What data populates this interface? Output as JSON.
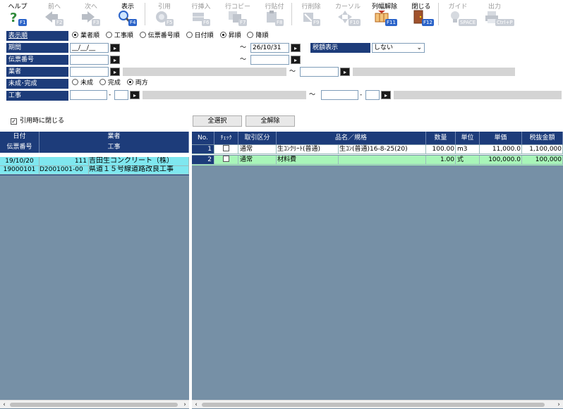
{
  "toolbar": {
    "help": {
      "label": "ヘルプ",
      "key": "F1",
      "icon": "help-question-icon"
    },
    "prev": {
      "label": "前へ",
      "key": "F2",
      "icon": "arrow-left-icon"
    },
    "next": {
      "label": "次へ",
      "key": "F3",
      "icon": "arrow-right-icon"
    },
    "show": {
      "label": "表示",
      "key": "F4",
      "icon": "magnifier-icon"
    },
    "cite": {
      "label": "引用",
      "key": "F5",
      "icon": "cite-icon"
    },
    "row_insert": {
      "label": "行挿入",
      "key": "F6",
      "icon": "row-insert-icon"
    },
    "row_copy": {
      "label": "行コピー",
      "key": "F7",
      "icon": "row-copy-icon"
    },
    "row_paste": {
      "label": "行貼付",
      "key": "F8",
      "icon": "row-paste-icon"
    },
    "row_delete": {
      "label": "行削除",
      "key": "F9",
      "icon": "row-delete-icon"
    },
    "cursor": {
      "label": "カーソル",
      "key": "F10",
      "icon": "cursor-icon"
    },
    "col_reset": {
      "label": "列幅解除",
      "key": "F11",
      "icon": "column-width-icon"
    },
    "close": {
      "label": "閉じる",
      "key": "F12",
      "icon": "door-close-icon"
    },
    "guide": {
      "label": "ガイド",
      "key": "SPACE",
      "icon": "lightbulb-icon"
    },
    "output": {
      "label": "出力",
      "key": "Ctrl+P",
      "icon": "printer-icon"
    }
  },
  "form": {
    "order_label": "表示順",
    "order_options": [
      "業者順",
      "工事順",
      "伝票番号順",
      "日付順"
    ],
    "order_selected": "業者順",
    "dir_options": [
      "昇順",
      "降順"
    ],
    "dir_selected": "昇順",
    "period_label": "期間",
    "period_from": "__/__/__",
    "period_to": "26/10/31",
    "tilde": "～",
    "tax_label": "税額表示",
    "tax_value": "しない",
    "slip_label": "伝票番号",
    "vendor_label": "業者",
    "status_label": "未成･完成",
    "status_options": [
      "未成",
      "完成",
      "両方"
    ],
    "status_selected": "両方",
    "work_label": "工事",
    "dash": "-",
    "close_on_cite": "引用時に閉じる",
    "select_all": "全選択",
    "deselect_all": "全解除"
  },
  "left_grid": {
    "headers": {
      "date": "日付",
      "vendor": "業者",
      "slip": "伝票番号",
      "work": "工事"
    },
    "rows": [
      {
        "date": "19/10/20",
        "code": "111",
        "vendor": "吉田生コンクリート（株）",
        "slip": "19000101",
        "work_code": "D2001001-00",
        "work": "県道１５号線道路改良工事"
      }
    ]
  },
  "right_grid": {
    "headers": [
      "No.",
      "ﾁｪｯｸ",
      "取引区分",
      "品名／規格",
      "数量",
      "単位",
      "単価",
      "税抜金額"
    ],
    "rows": [
      {
        "no": "1",
        "kind": "通常",
        "name": "生ｺﾝｸﾘｰﾄ(普通)",
        "spec": "生ｺﾝ(普通)16-8-25(20)",
        "qty": "100.00",
        "unit": "m3",
        "price": "11,000.0",
        "amount": "1,100,000"
      },
      {
        "no": "2",
        "kind": "通常",
        "name": "材料費",
        "spec": "",
        "qty": "1.00",
        "unit": "式",
        "price": "100,000.0",
        "amount": "100,000"
      }
    ]
  },
  "colors": {
    "accent": "#1d3c7a",
    "row_cyan": "#7fe7ef",
    "row_green": "#a8f5b8",
    "pane": "#7690a6"
  }
}
